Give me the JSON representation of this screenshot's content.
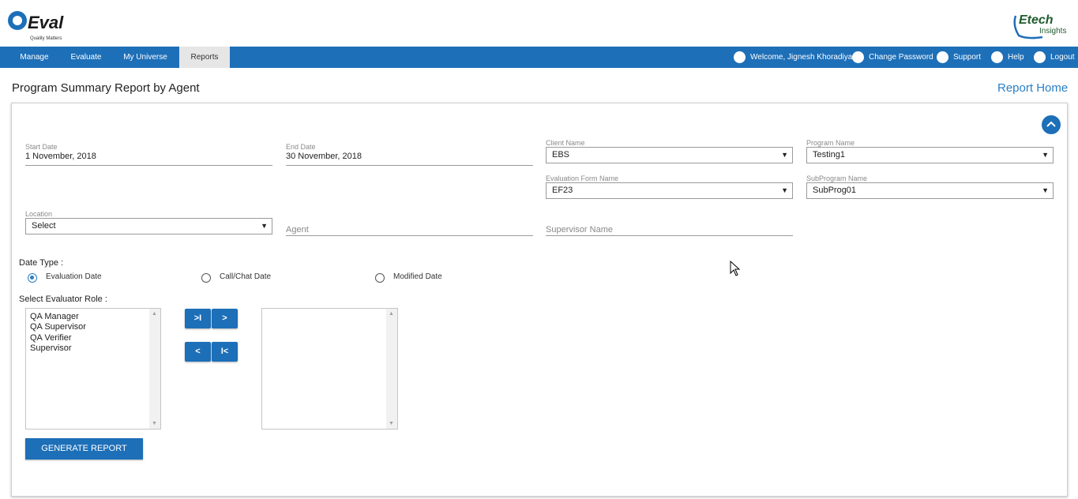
{
  "header": {
    "logo_left": {
      "text": "Q-eval",
      "tagline": "Quality Matters"
    },
    "logo_right": {
      "line1": "Etech",
      "line2": "Insights"
    }
  },
  "nav": {
    "items": [
      {
        "label": "Manage"
      },
      {
        "label": "Evaluate"
      },
      {
        "label": "My Universe"
      },
      {
        "label": "Reports",
        "active": true
      }
    ],
    "right": {
      "welcome": "Welcome, Jignesh Khoradiya",
      "change_password": "Change Password",
      "support": "Support",
      "help": "Help",
      "logout": "Logout"
    }
  },
  "page": {
    "title": "Program Summary Report by Agent",
    "report_home": "Report Home"
  },
  "form": {
    "start_date": {
      "label": "Start Date",
      "value": "1 November, 2018"
    },
    "end_date": {
      "label": "End Date",
      "value": "30 November, 2018"
    },
    "client_name": {
      "label": "Client Name",
      "value": "EBS"
    },
    "program_name": {
      "label": "Program Name",
      "value": "Testing1"
    },
    "evaluation_form": {
      "label": "Evaluation Form Name",
      "value": "EF23"
    },
    "subprogram": {
      "label": "SubProgram Name",
      "value": "SubProg01"
    },
    "location": {
      "label": "Location",
      "value": "Select"
    },
    "agent": {
      "placeholder": "Agent"
    },
    "supervisor": {
      "placeholder": "Supervisor Name"
    },
    "date_type": {
      "label": "Date Type :",
      "options": [
        {
          "label": "Evaluation Date",
          "checked": true
        },
        {
          "label": "Call/Chat Date",
          "checked": false
        },
        {
          "label": "Modified Date",
          "checked": false
        }
      ]
    },
    "evaluator_role": {
      "label": "Select Evaluator Role :",
      "available": [
        "QA Manager",
        "QA Supervisor",
        "QA Verifier",
        "Supervisor"
      ],
      "selected": [],
      "buttons": {
        "move_all_right": ">I",
        "move_right": ">",
        "move_left": "<",
        "move_all_left": "I<"
      }
    },
    "generate_button": "GENERATE REPORT"
  },
  "colors": {
    "nav_bg": "#1d6fb8",
    "link": "#2a7fc4",
    "button": "#1d6fb8"
  }
}
